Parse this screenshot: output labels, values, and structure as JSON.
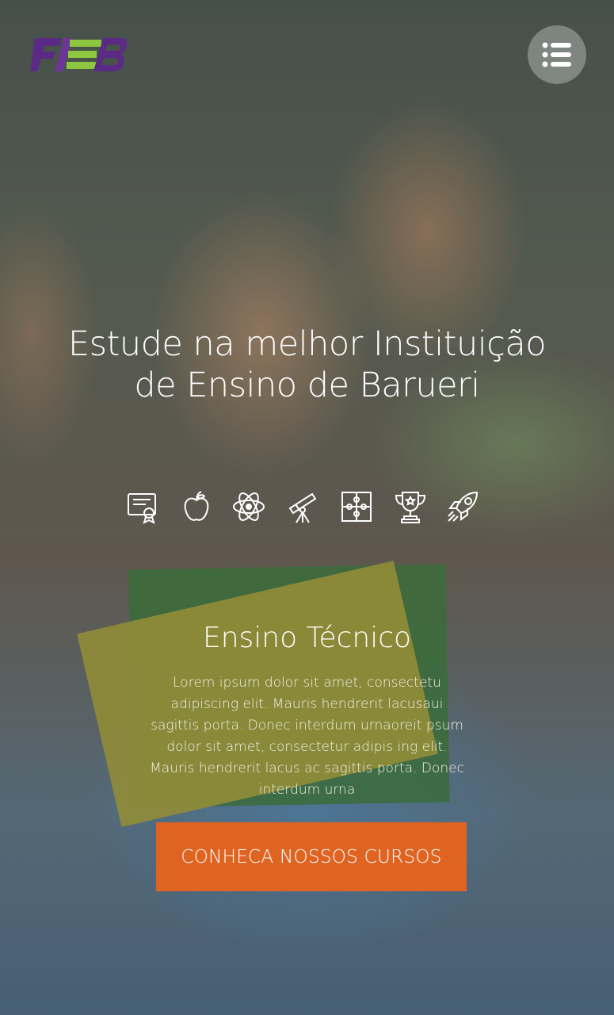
{
  "header": {
    "logo_text": "FIEB",
    "menu_icon": "list-icon"
  },
  "hero": {
    "headline_line1": "Estude na melhor Instituição",
    "headline_line2": "de Ensino de Barueri"
  },
  "features": {
    "icons": [
      "certificate-icon",
      "apple-icon",
      "atom-icon",
      "telescope-icon",
      "puzzle-icon",
      "trophy-icon",
      "rocket-icon"
    ]
  },
  "section": {
    "title": "Ensino Técnico",
    "body": "Lorem ipsum dolor sit amet, consectetu adipiscing elit. Mauris hendrerit lacusaui sagittis porta. Donec interdum urnaoreit psum dolor sit amet, consectetur adipis ing elit. Mauris hendrerit lacus ac sagittis porta. Donec interdum urna",
    "cta_label": "CONHECA NOSSOS CURSOS"
  },
  "colors": {
    "cta": "#df6422",
    "logo_purple": "#5b2a86",
    "logo_green": "#8dc63f"
  }
}
